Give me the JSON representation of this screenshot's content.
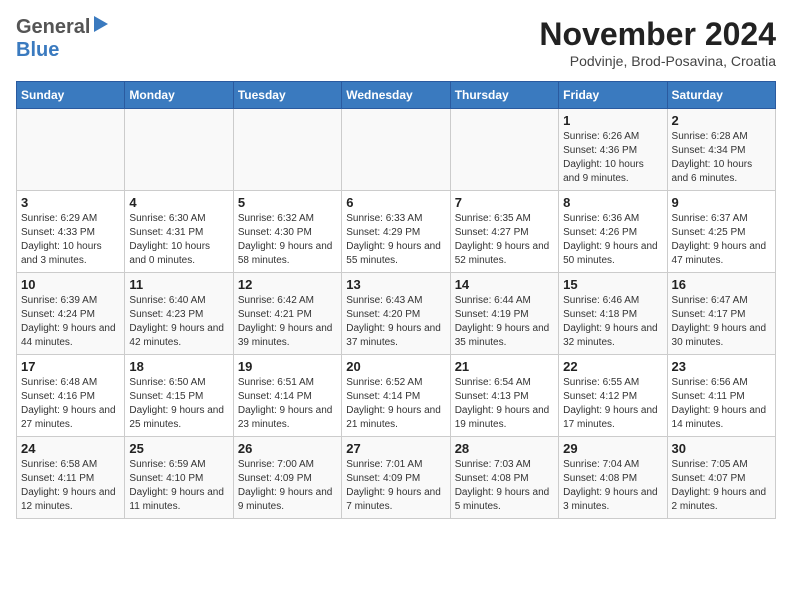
{
  "header": {
    "logo_general": "General",
    "logo_blue": "Blue",
    "title": "November 2024",
    "subtitle": "Podvinje, Brod-Posavina, Croatia"
  },
  "calendar": {
    "days_of_week": [
      "Sunday",
      "Monday",
      "Tuesday",
      "Wednesday",
      "Thursday",
      "Friday",
      "Saturday"
    ],
    "weeks": [
      [
        {
          "day": "",
          "info": ""
        },
        {
          "day": "",
          "info": ""
        },
        {
          "day": "",
          "info": ""
        },
        {
          "day": "",
          "info": ""
        },
        {
          "day": "",
          "info": ""
        },
        {
          "day": "1",
          "info": "Sunrise: 6:26 AM\nSunset: 4:36 PM\nDaylight: 10 hours and 9 minutes."
        },
        {
          "day": "2",
          "info": "Sunrise: 6:28 AM\nSunset: 4:34 PM\nDaylight: 10 hours and 6 minutes."
        }
      ],
      [
        {
          "day": "3",
          "info": "Sunrise: 6:29 AM\nSunset: 4:33 PM\nDaylight: 10 hours and 3 minutes."
        },
        {
          "day": "4",
          "info": "Sunrise: 6:30 AM\nSunset: 4:31 PM\nDaylight: 10 hours and 0 minutes."
        },
        {
          "day": "5",
          "info": "Sunrise: 6:32 AM\nSunset: 4:30 PM\nDaylight: 9 hours and 58 minutes."
        },
        {
          "day": "6",
          "info": "Sunrise: 6:33 AM\nSunset: 4:29 PM\nDaylight: 9 hours and 55 minutes."
        },
        {
          "day": "7",
          "info": "Sunrise: 6:35 AM\nSunset: 4:27 PM\nDaylight: 9 hours and 52 minutes."
        },
        {
          "day": "8",
          "info": "Sunrise: 6:36 AM\nSunset: 4:26 PM\nDaylight: 9 hours and 50 minutes."
        },
        {
          "day": "9",
          "info": "Sunrise: 6:37 AM\nSunset: 4:25 PM\nDaylight: 9 hours and 47 minutes."
        }
      ],
      [
        {
          "day": "10",
          "info": "Sunrise: 6:39 AM\nSunset: 4:24 PM\nDaylight: 9 hours and 44 minutes."
        },
        {
          "day": "11",
          "info": "Sunrise: 6:40 AM\nSunset: 4:23 PM\nDaylight: 9 hours and 42 minutes."
        },
        {
          "day": "12",
          "info": "Sunrise: 6:42 AM\nSunset: 4:21 PM\nDaylight: 9 hours and 39 minutes."
        },
        {
          "day": "13",
          "info": "Sunrise: 6:43 AM\nSunset: 4:20 PM\nDaylight: 9 hours and 37 minutes."
        },
        {
          "day": "14",
          "info": "Sunrise: 6:44 AM\nSunset: 4:19 PM\nDaylight: 9 hours and 35 minutes."
        },
        {
          "day": "15",
          "info": "Sunrise: 6:46 AM\nSunset: 4:18 PM\nDaylight: 9 hours and 32 minutes."
        },
        {
          "day": "16",
          "info": "Sunrise: 6:47 AM\nSunset: 4:17 PM\nDaylight: 9 hours and 30 minutes."
        }
      ],
      [
        {
          "day": "17",
          "info": "Sunrise: 6:48 AM\nSunset: 4:16 PM\nDaylight: 9 hours and 27 minutes."
        },
        {
          "day": "18",
          "info": "Sunrise: 6:50 AM\nSunset: 4:15 PM\nDaylight: 9 hours and 25 minutes."
        },
        {
          "day": "19",
          "info": "Sunrise: 6:51 AM\nSunset: 4:14 PM\nDaylight: 9 hours and 23 minutes."
        },
        {
          "day": "20",
          "info": "Sunrise: 6:52 AM\nSunset: 4:14 PM\nDaylight: 9 hours and 21 minutes."
        },
        {
          "day": "21",
          "info": "Sunrise: 6:54 AM\nSunset: 4:13 PM\nDaylight: 9 hours and 19 minutes."
        },
        {
          "day": "22",
          "info": "Sunrise: 6:55 AM\nSunset: 4:12 PM\nDaylight: 9 hours and 17 minutes."
        },
        {
          "day": "23",
          "info": "Sunrise: 6:56 AM\nSunset: 4:11 PM\nDaylight: 9 hours and 14 minutes."
        }
      ],
      [
        {
          "day": "24",
          "info": "Sunrise: 6:58 AM\nSunset: 4:11 PM\nDaylight: 9 hours and 12 minutes."
        },
        {
          "day": "25",
          "info": "Sunrise: 6:59 AM\nSunset: 4:10 PM\nDaylight: 9 hours and 11 minutes."
        },
        {
          "day": "26",
          "info": "Sunrise: 7:00 AM\nSunset: 4:09 PM\nDaylight: 9 hours and 9 minutes."
        },
        {
          "day": "27",
          "info": "Sunrise: 7:01 AM\nSunset: 4:09 PM\nDaylight: 9 hours and 7 minutes."
        },
        {
          "day": "28",
          "info": "Sunrise: 7:03 AM\nSunset: 4:08 PM\nDaylight: 9 hours and 5 minutes."
        },
        {
          "day": "29",
          "info": "Sunrise: 7:04 AM\nSunset: 4:08 PM\nDaylight: 9 hours and 3 minutes."
        },
        {
          "day": "30",
          "info": "Sunrise: 7:05 AM\nSunset: 4:07 PM\nDaylight: 9 hours and 2 minutes."
        }
      ]
    ]
  }
}
